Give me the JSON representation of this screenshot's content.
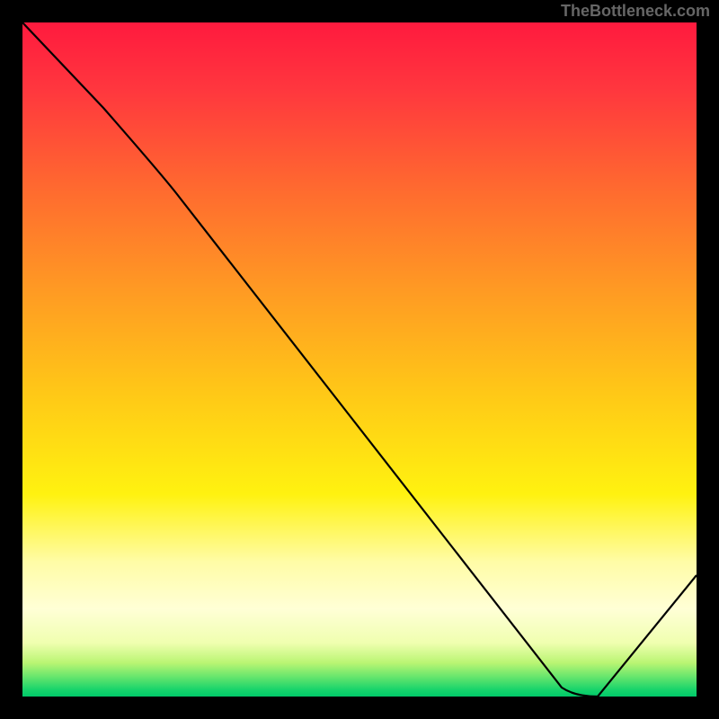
{
  "watermark": "TheBottleneck.com",
  "chart_data": {
    "type": "line",
    "title": "",
    "xlabel": "",
    "ylabel": "",
    "x": [
      0,
      12,
      22,
      82,
      85,
      100
    ],
    "y": [
      100,
      87,
      77,
      0,
      0,
      18
    ],
    "ylim": [
      0,
      100
    ],
    "xlim": [
      0,
      100
    ],
    "annotations": [
      {
        "x": 82,
        "y": 0,
        "text": ""
      }
    ],
    "gradient_stops": [
      {
        "pos": 0,
        "color": "#ff1a3e"
      },
      {
        "pos": 10,
        "color": "#ff373e"
      },
      {
        "pos": 25,
        "color": "#ff6b2f"
      },
      {
        "pos": 40,
        "color": "#ff9b23"
      },
      {
        "pos": 55,
        "color": "#ffc817"
      },
      {
        "pos": 70,
        "color": "#fff210"
      },
      {
        "pos": 80,
        "color": "#fffca6"
      },
      {
        "pos": 87,
        "color": "#ffffd6"
      },
      {
        "pos": 92,
        "color": "#f0ffb0"
      },
      {
        "pos": 95,
        "color": "#baf573"
      },
      {
        "pos": 97,
        "color": "#6ae66d"
      },
      {
        "pos": 99,
        "color": "#17d46b"
      },
      {
        "pos": 100,
        "color": "#00c96a"
      }
    ]
  }
}
